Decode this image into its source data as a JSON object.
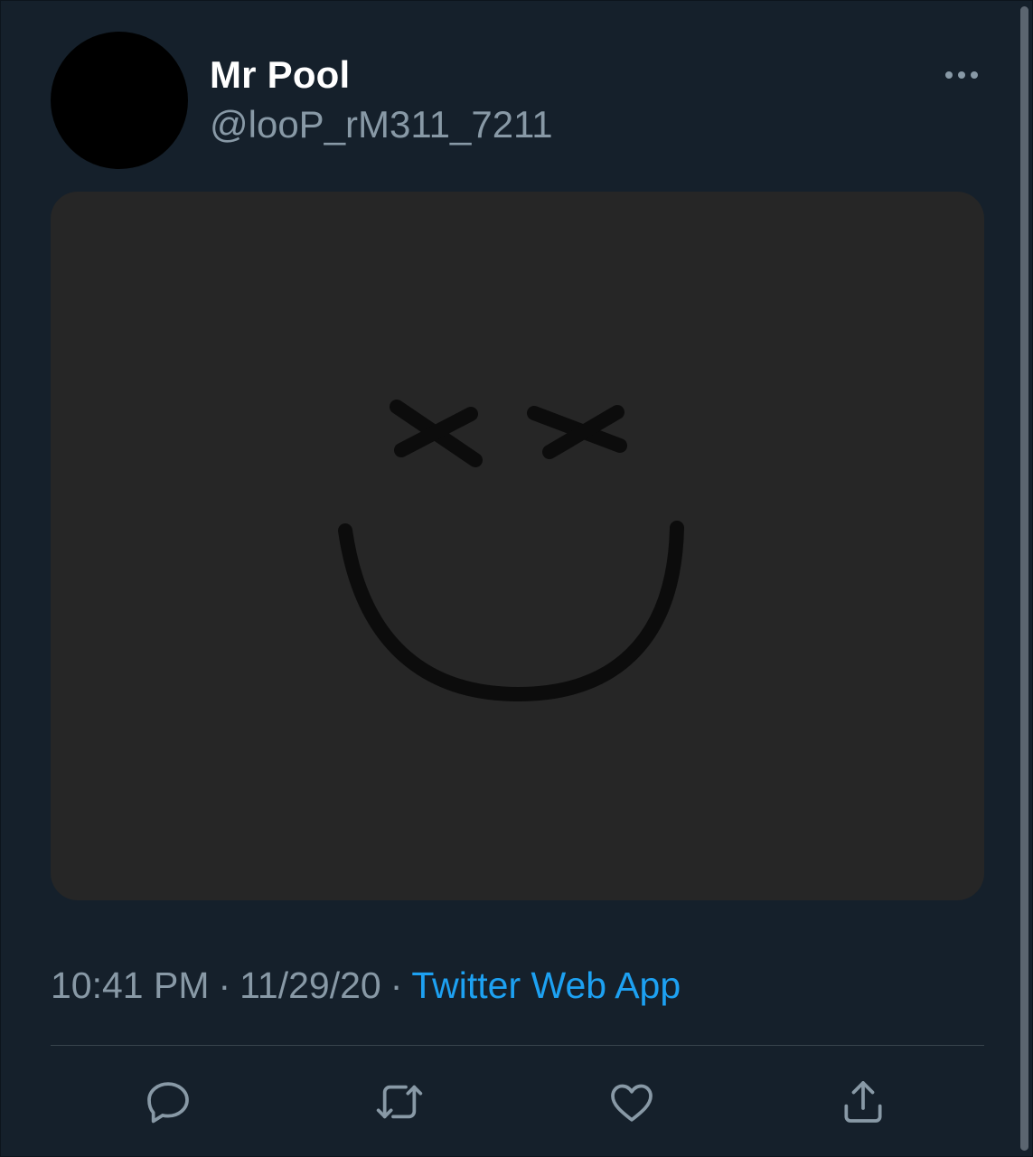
{
  "tweet": {
    "display_name": "Mr Pool",
    "handle": "@looP_rM311_7211",
    "time": "10:41 PM",
    "separator": "·",
    "date": "11/29/20",
    "source": "Twitter Web App"
  },
  "icons": {
    "more": "more-horizontal-icon",
    "reply": "reply-icon",
    "retweet": "retweet-icon",
    "like": "like-icon",
    "share": "share-icon"
  },
  "colors": {
    "background": "#15202b",
    "text_primary": "#ffffff",
    "text_secondary": "#8899a6",
    "link": "#1da1f2",
    "media_bg": "#262626"
  }
}
